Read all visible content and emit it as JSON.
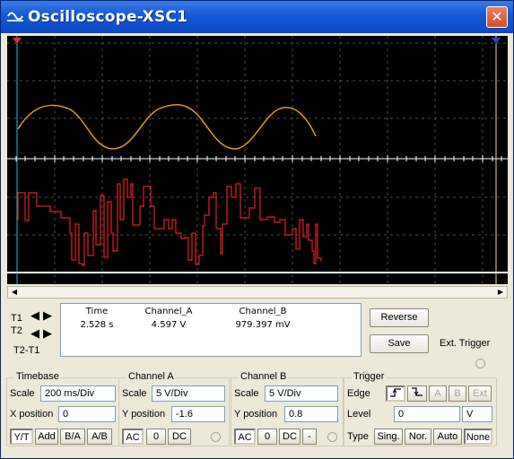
{
  "window": {
    "title": "Oscilloscope-XSC1",
    "close_label": "✕"
  },
  "cursors": {
    "t1_label": "T1",
    "t2_label": "T2",
    "diff_label": "T2-T1"
  },
  "readout": {
    "headers": [
      "Time",
      "Channel_A",
      "Channel_B"
    ],
    "row_t1": [
      "2.528 s",
      "4.597 V",
      "979.397 mV"
    ]
  },
  "buttons": {
    "reverse": "Reverse",
    "save": "Save",
    "ext_trigger": "Ext. Trigger"
  },
  "timebase": {
    "title": "Timebase",
    "scale_label": "Scale",
    "scale_value": "200 ms/Div",
    "xpos_label": "X position",
    "xpos_value": "0",
    "modes": [
      "Y/T",
      "Add",
      "B/A",
      "A/B"
    ],
    "active_mode": "Y/T"
  },
  "channel_a": {
    "title": "Channel A",
    "scale_label": "Scale",
    "scale_value": "5  V/Div",
    "ypos_label": "Y position",
    "ypos_value": "-1.6",
    "coupling": [
      "AC",
      "0",
      "DC"
    ]
  },
  "channel_b": {
    "title": "Channel B",
    "scale_label": "Scale",
    "scale_value": "5  V/Div",
    "ypos_label": "Y position",
    "ypos_value": "0.8",
    "coupling": [
      "AC",
      "0",
      "DC",
      "-"
    ]
  },
  "trigger": {
    "title": "Trigger",
    "edge_label": "Edge",
    "edge_buttons": [
      "A",
      "B",
      "Ext"
    ],
    "level_label": "Level",
    "level_value": "0",
    "level_unit": "V",
    "type_label": "Type",
    "types": [
      "Sing.",
      "Nor.",
      "Auto",
      "None"
    ],
    "active_type": "None"
  },
  "colors": {
    "channel_a": "#e8961e",
    "channel_b": "#e61e1e",
    "cursor1": "#2fb7d8",
    "cursor2": "#e8e84a",
    "screen_bg": "#000000",
    "grid": "#4c4c4c"
  }
}
